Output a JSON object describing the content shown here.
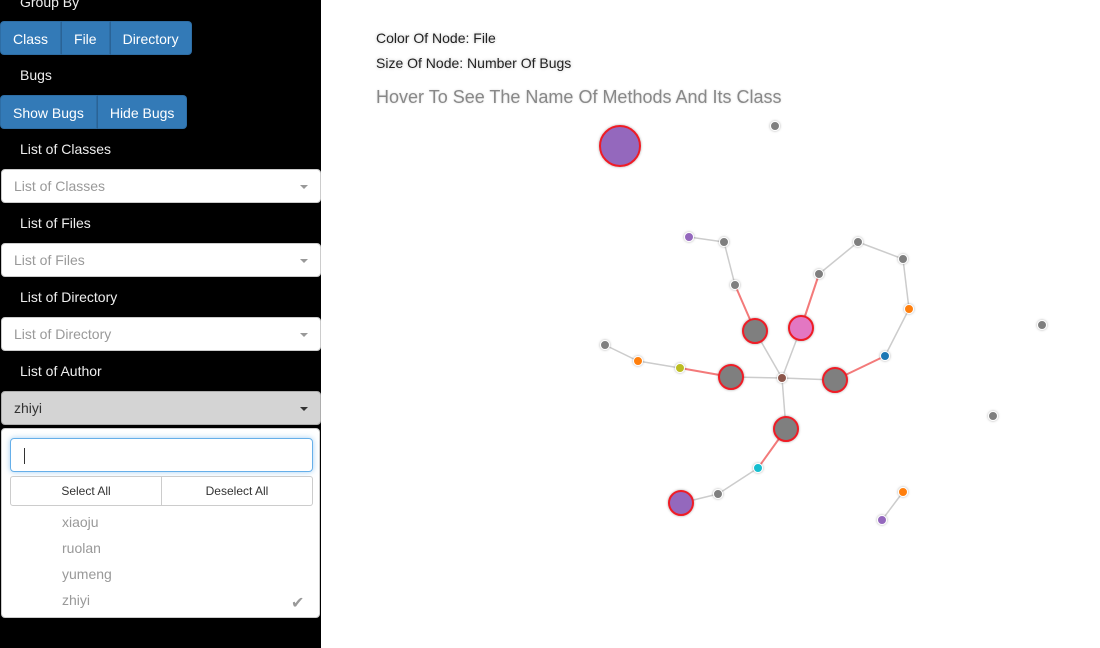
{
  "sidebar": {
    "group_by": {
      "label": "Group By",
      "buttons": [
        "Class",
        "File",
        "Directory"
      ]
    },
    "bugs": {
      "label": "Bugs",
      "buttons": [
        "Show Bugs",
        "Hide Bugs"
      ]
    },
    "classes": {
      "label": "List of Classes",
      "placeholder": "List of Classes"
    },
    "files": {
      "label": "List of Files",
      "placeholder": "List of Files"
    },
    "directory": {
      "label": "List of Directory",
      "placeholder": "List of Directory"
    },
    "author": {
      "label": "List of Author",
      "selected": "zhiyi",
      "search_value": "",
      "select_all": "Select All",
      "deselect_all": "Deselect All",
      "options": [
        "xiaoju",
        "ruolan",
        "yumeng",
        "zhiyi"
      ],
      "checked_option": "zhiyi",
      "check_icon": "checkmark-icon"
    }
  },
  "graph_info": {
    "color_line": "Color Of Node: File",
    "size_line": "Size Of Node: Number Of Bugs",
    "hint": "Hover To See The Name Of Methods And Its Class"
  },
  "colors": {
    "button_blue": "#337ab7",
    "bug_outline": "#ee1c25",
    "bug_link": "#f37a7a",
    "default_node": "#7f7f7f"
  }
}
